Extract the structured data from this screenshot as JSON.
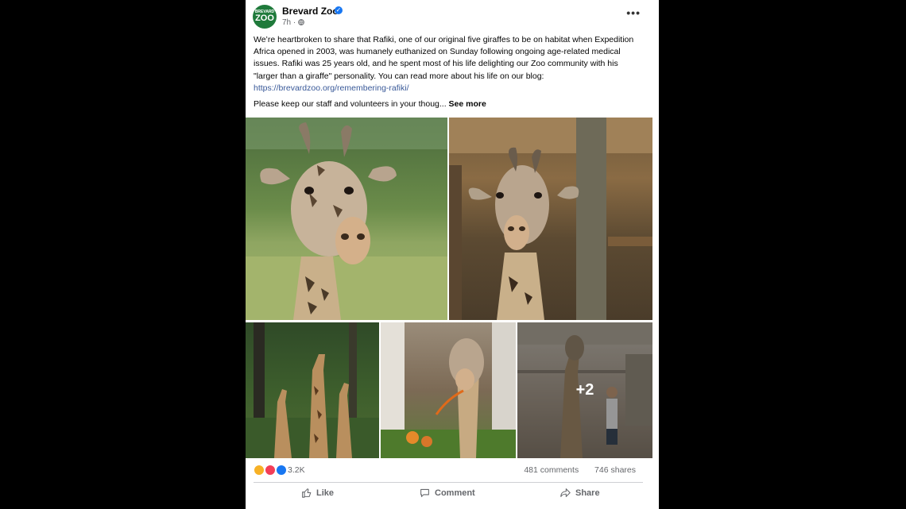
{
  "post": {
    "page_name": "Brevard Zoo",
    "avatar_text_top": "BREVARD",
    "avatar_text_main": "ZOO",
    "time": "7h",
    "audience_icon": "globe-icon",
    "text": "We’re heartbroken to share that Rafiki, one of our original five giraffes to be on habitat when Expedition Africa opened in 2003, was humanely euthanized on Sunday following ongoing age-related medical issues. Rafiki was 25 years old, and he spent most of his life delighting our Zoo community with his \"larger than a giraffe\" personality. You can read more about his life on our blog: ",
    "link": "https://brevardzoo.org/remembering-rafiki/",
    "text2": "Please keep our staff and volunteers in your thoug... ",
    "see_more": "See more",
    "more_photos": "+2"
  },
  "stats": {
    "reaction_count": "3.2K",
    "comments": "481 comments",
    "shares": "746 shares"
  },
  "actions": {
    "like": "Like",
    "comment": "Comment",
    "share": "Share"
  },
  "colors": {
    "link": "#385898",
    "muted": "#65676b",
    "verified": "#1877f2"
  }
}
